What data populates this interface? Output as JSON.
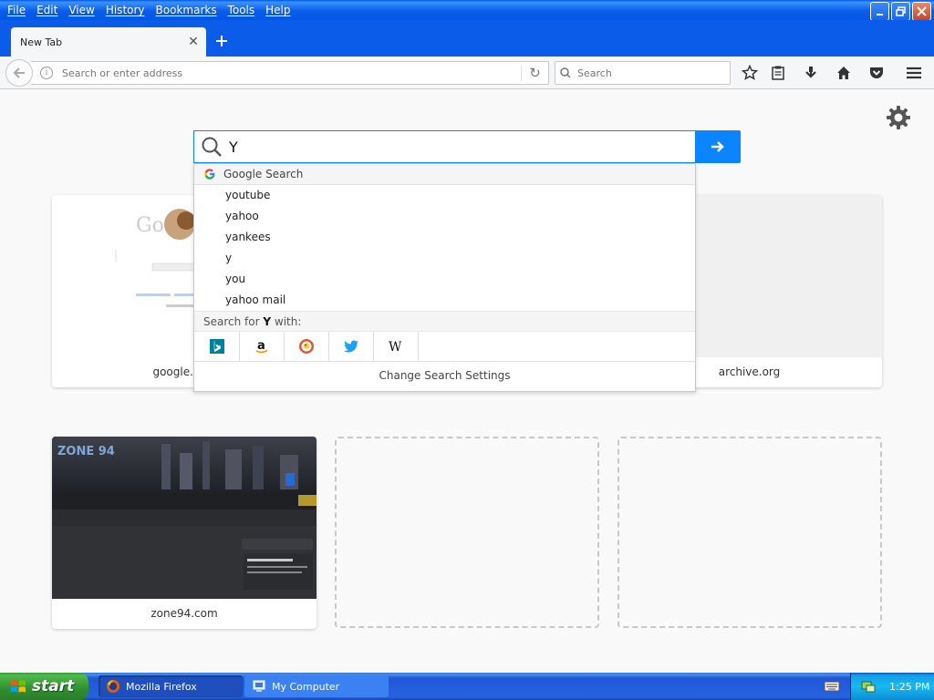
{
  "menu": [
    "File",
    "Edit",
    "View",
    "History",
    "Bookmarks",
    "Tools",
    "Help"
  ],
  "tab": {
    "title": "New Tab"
  },
  "nav": {
    "url_placeholder": "Search or enter address",
    "search_placeholder": "Search"
  },
  "newtab_search": {
    "value": "Y"
  },
  "dropdown": {
    "engine_header": "Google Search",
    "suggestions": [
      "youtube",
      "yahoo",
      "yankees",
      "y",
      "you",
      "yahoo mail"
    ],
    "search_for_prefix": "Search for ",
    "search_for_term": "Y",
    "search_for_suffix": " with:",
    "engines": [
      "bing-icon",
      "amazon-icon",
      "duckduckgo-icon",
      "twitter-icon",
      "wikipedia-icon"
    ],
    "settings_label": "Change Search Settings"
  },
  "tiles": {
    "tile1": {
      "label": "google.com"
    },
    "tile2": {
      "label": "archive.org"
    },
    "tile3": {
      "label": "zone94.com"
    }
  },
  "taskbar": {
    "start_label": "start",
    "tasks": [
      "Mozilla Firefox",
      "My Computer"
    ],
    "clock": "1:25 PM"
  },
  "colors": {
    "accent": "#0a84ff",
    "xp_blue": "#0a5ce9",
    "start_green": "#3c9a3c"
  }
}
